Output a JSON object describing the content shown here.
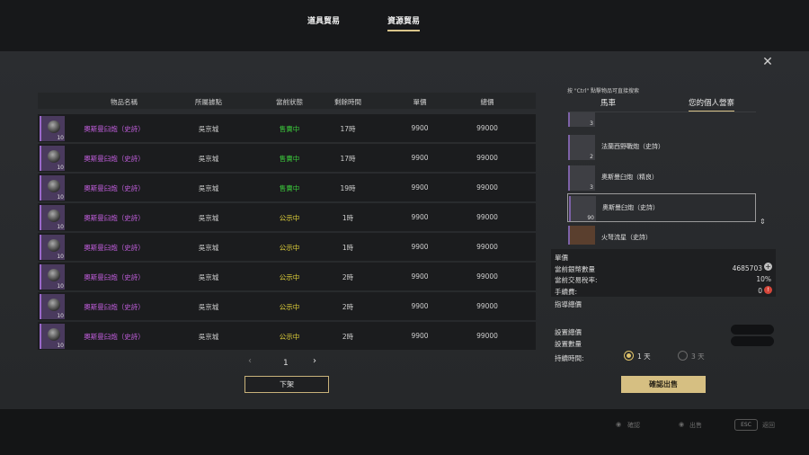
{
  "tabs": [
    "道具貿易",
    "資源貿易"
  ],
  "table": {
    "headers": [
      "物品名稱",
      "所屬據點",
      "當前狀態",
      "剩餘時間",
      "單價",
      "總價"
    ],
    "rows": [
      {
        "count": "10",
        "name": "奧斯曼臼炮（史詩）",
        "location": "吳京城",
        "status": "售賣中",
        "status_type": "sell",
        "time": "17時",
        "price": "9900",
        "total": "99000"
      },
      {
        "count": "10",
        "name": "奧斯曼臼炮（史詩）",
        "location": "吳京城",
        "status": "售賣中",
        "status_type": "sell",
        "time": "17時",
        "price": "9900",
        "total": "99000"
      },
      {
        "count": "10",
        "name": "奧斯曼臼炮（史詩）",
        "location": "吳京城",
        "status": "售賣中",
        "status_type": "sell",
        "time": "19時",
        "price": "9900",
        "total": "99000"
      },
      {
        "count": "10",
        "name": "奧斯曼臼炮（史詩）",
        "location": "吳京城",
        "status": "公示中",
        "status_type": "pub",
        "time": "1時",
        "price": "9900",
        "total": "99000"
      },
      {
        "count": "10",
        "name": "奧斯曼臼炮（史詩）",
        "location": "吳京城",
        "status": "公示中",
        "status_type": "pub",
        "time": "1時",
        "price": "9900",
        "total": "99000"
      },
      {
        "count": "10",
        "name": "奧斯曼臼炮（史詩）",
        "location": "吳京城",
        "status": "公示中",
        "status_type": "pub",
        "time": "2時",
        "price": "9900",
        "total": "99000"
      },
      {
        "count": "10",
        "name": "奧斯曼臼炮（史詩）",
        "location": "吳京城",
        "status": "公示中",
        "status_type": "pub",
        "time": "2時",
        "price": "9900",
        "total": "99000"
      },
      {
        "count": "10",
        "name": "奧斯曼臼炮（史詩）",
        "location": "吳京城",
        "status": "公示中",
        "status_type": "pub",
        "time": "2時",
        "price": "9900",
        "total": "99000"
      }
    ]
  },
  "pager": {
    "page": "1",
    "prev_icon": "chevron-left-icon",
    "next_icon": "chevron-right-icon"
  },
  "delist_label": "下架",
  "right": {
    "hint": "按 \"Ctrl\" 點擊物品可直接搜索",
    "tabs": [
      "馬車",
      "您的個人營寨"
    ],
    "items": [
      {
        "name": "",
        "count": "3"
      },
      {
        "name": "法蘭西野戰炮（史詩）",
        "count": "2"
      },
      {
        "name": "奧斯曼臼炮（精良）",
        "count": "3"
      },
      {
        "name": "奧斯曼臼炮（史詩）",
        "count": "90"
      },
      {
        "name": "火弩流星（史詩）",
        "count": ""
      }
    ],
    "info": {
      "unit_price_label": "單價",
      "silver_label": "當前銀幣數量",
      "silver_value": "4685703",
      "tax_label": "當前交易稅率:",
      "tax_value": "10%",
      "fee_label": "手續費:",
      "fee_value": "0"
    },
    "guide_label": "指導總價",
    "set_total_label": "設置總價",
    "set_qty_label": "設置數量",
    "duration_label": "持續時間:",
    "duration_options": [
      "1 天",
      "3 天"
    ],
    "duration_selected": 0,
    "confirm_label": "確認出售"
  },
  "footer": {
    "keys": [
      "確認",
      "出售",
      "返回"
    ],
    "esc_label": "ESC"
  },
  "colors": {
    "accent": "#d6bf82",
    "sell": "#3ccc3c",
    "public": "#e2d23a",
    "epic": "#c45fe0"
  }
}
